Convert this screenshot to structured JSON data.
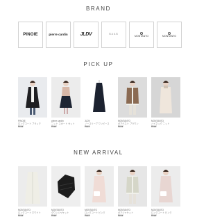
{
  "brand_section": {
    "title": "BRAND",
    "brands": [
      {
        "name": "PINOIE"
      },
      {
        "name": "pierre cardin"
      },
      {
        "name": "JLDV"
      },
      {
        "name": "BAAB"
      },
      {
        "name": "MONTANTO"
      },
      {
        "name": "MONTANTO"
      }
    ]
  },
  "pickup_section": {
    "title": "PICK UP",
    "items": [
      {
        "brand": "PINOIE",
        "desc": "ロングコート ブラック",
        "price": "¥###",
        "colors": {
          "bg": "#e9ebee",
          "main": "#1f1f22",
          "accent": "#f4f4f2"
        }
      },
      {
        "brand": "pierre cardin",
        "desc": "ニット スカート セット",
        "price": "¥###",
        "colors": {
          "bg": "#ececec",
          "main": "#1e2533",
          "accent": "#d8b8a8"
        }
      },
      {
        "brand": "JLDV",
        "desc": "ノースリーブ ワンピース",
        "price": "¥###",
        "colors": {
          "bg": "#ffffff",
          "main": "#1c2230",
          "accent": "#2a3142"
        }
      },
      {
        "brand": "MONTANTO",
        "desc": "ボアベスト ブラウン",
        "price": "¥###",
        "colors": {
          "bg": "#dcdcdc",
          "main": "#8a6a52",
          "accent": "#efefea"
        }
      },
      {
        "brand": "MONTANTO",
        "desc": "ハイネック ニット",
        "price": "¥###",
        "colors": {
          "bg": "#d6d6d6",
          "main": "#efe6dc",
          "accent": "#cfc2b4"
        }
      }
    ]
  },
  "arrival_section": {
    "title": "NEW ARRIVAL",
    "items": [
      {
        "brand": "MONTANTO",
        "desc": "ロングコート ホワイト",
        "price": "¥###",
        "colors": {
          "bg": "#ececec",
          "main": "#efeee6",
          "accent": "#d9d9d0"
        }
      },
      {
        "brand": "MONTANTO",
        "desc": "ダウンジャケット",
        "price": "¥###",
        "colors": {
          "bg": "#eeeeee",
          "main": "#1c1c1c",
          "accent": "#3b3b3b"
        }
      },
      {
        "brand": "MONTANTO",
        "desc": "ロングコート ピンク",
        "price": "¥###",
        "colors": {
          "bg": "#ededed",
          "main": "#f0dcd6",
          "accent": "#ffffff"
        }
      },
      {
        "brand": "MONTANTO",
        "desc": "ボアジャケット",
        "price": "¥###",
        "colors": {
          "bg": "#e6e6e6",
          "main": "#d5d6c8",
          "accent": "#f0f0ea"
        }
      },
      {
        "brand": "MONTANTO",
        "desc": "ロングコート ピンク",
        "price": "¥###",
        "colors": {
          "bg": "#ececec",
          "main": "#e8d6d2",
          "accent": "#ffffff"
        }
      }
    ]
  }
}
